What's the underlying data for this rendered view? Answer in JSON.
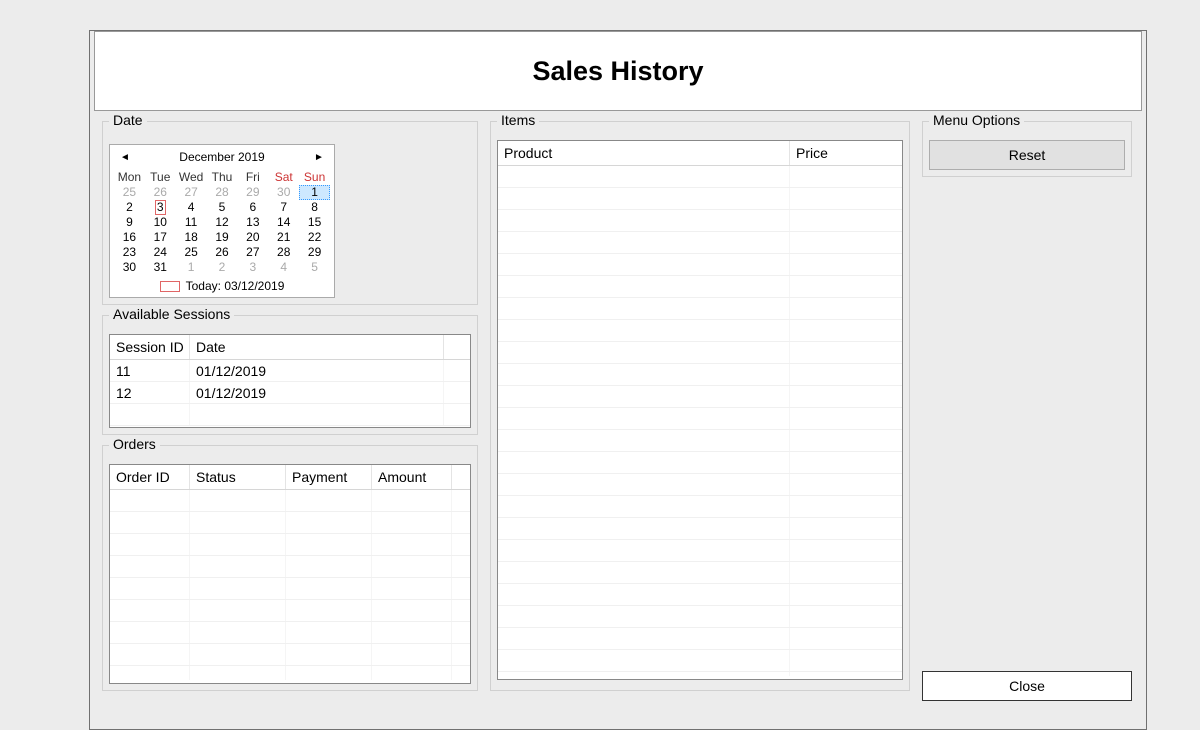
{
  "title": "Sales History",
  "groups": {
    "date": "Date",
    "sessions": "Available Sessions",
    "orders": "Orders",
    "items": "Items",
    "menu": "Menu Options"
  },
  "calendar": {
    "month_label": "December 2019",
    "dow": [
      "Mon",
      "Tue",
      "Wed",
      "Thu",
      "Fri",
      "Sat",
      "Sun"
    ],
    "today_label": "Today: 03/12/2019",
    "selected_day": 1,
    "today_day": 3,
    "weeks": [
      {
        "days": [
          {
            "n": 25,
            "out": true
          },
          {
            "n": 26,
            "out": true
          },
          {
            "n": 27,
            "out": true
          },
          {
            "n": 28,
            "out": true
          },
          {
            "n": 29,
            "out": true
          },
          {
            "n": 30,
            "out": true
          },
          {
            "n": 1
          }
        ]
      },
      {
        "days": [
          {
            "n": 2
          },
          {
            "n": 3
          },
          {
            "n": 4
          },
          {
            "n": 5
          },
          {
            "n": 6
          },
          {
            "n": 7
          },
          {
            "n": 8
          }
        ]
      },
      {
        "days": [
          {
            "n": 9
          },
          {
            "n": 10
          },
          {
            "n": 11
          },
          {
            "n": 12
          },
          {
            "n": 13
          },
          {
            "n": 14
          },
          {
            "n": 15
          }
        ]
      },
      {
        "days": [
          {
            "n": 16
          },
          {
            "n": 17
          },
          {
            "n": 18
          },
          {
            "n": 19
          },
          {
            "n": 20
          },
          {
            "n": 21
          },
          {
            "n": 22
          }
        ]
      },
      {
        "days": [
          {
            "n": 23
          },
          {
            "n": 24
          },
          {
            "n": 25
          },
          {
            "n": 26
          },
          {
            "n": 27
          },
          {
            "n": 28
          },
          {
            "n": 29
          }
        ]
      },
      {
        "days": [
          {
            "n": 30
          },
          {
            "n": 31
          },
          {
            "n": 1,
            "out": true
          },
          {
            "n": 2,
            "out": true
          },
          {
            "n": 3,
            "out": true
          },
          {
            "n": 4,
            "out": true
          },
          {
            "n": 5,
            "out": true
          }
        ]
      }
    ]
  },
  "sessions": {
    "columns": [
      "Session ID",
      "Date"
    ],
    "rows": [
      {
        "id": "11",
        "date": "01/12/2019"
      },
      {
        "id": "12",
        "date": "01/12/2019"
      }
    ]
  },
  "orders": {
    "columns": [
      "Order ID",
      "Status",
      "Payment",
      "Amount"
    ],
    "rows": []
  },
  "items": {
    "columns": [
      "Product",
      "Price"
    ],
    "rows": []
  },
  "buttons": {
    "reset": "Reset",
    "close": "Close"
  }
}
